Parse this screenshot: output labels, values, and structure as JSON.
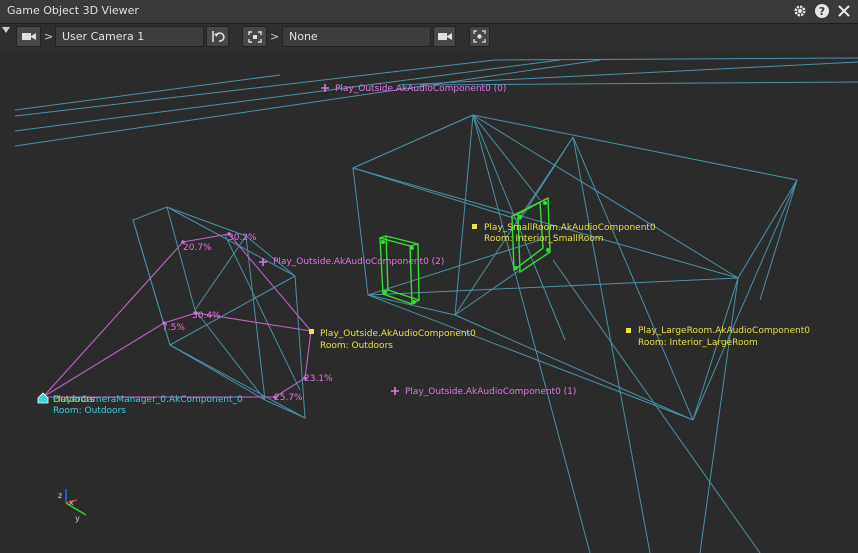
{
  "window": {
    "title": "Game Object 3D Viewer"
  },
  "toolbar": {
    "camera_value": "User Camera 1",
    "target_value": "None",
    "chevron": ">"
  },
  "labels": {
    "outside0_title": "Play_Outside.AkAudioComponent0 (0)",
    "outside1_title": "Play_Outside.AkAudioComponent0 (1)",
    "outside2_title": "Play_Outside.AkAudioComponent0 (2)",
    "outside_main_title": "Play_Outside.AkAudioComponent0",
    "outside_main_room": "Room: Outdoors",
    "small_title": "Play_SmallRoom.AkAudioComponent0",
    "small_room": "Room: Interior_SmallRoom",
    "large_title": "Play_LargeRoom.AkAudioComponent0",
    "large_room": "Room: Interior_LargeRoom",
    "listener_overlap": "Outdoors",
    "listener_title": "PlayerCameraManager_0.AkComponent_0",
    "listener_room": "Room: Outdoors"
  },
  "percentages": {
    "p1": "20.7%",
    "p2": "30.2%",
    "p3": "30.4%",
    "p4": "7.5%",
    "p5": "23.1%",
    "p6": "25.7%"
  },
  "axes": {
    "z": "z",
    "x": "x",
    "y": "y"
  },
  "colors": {
    "wire": "#4a8fa8",
    "path": "#c060c8",
    "emitter": "#e276e4",
    "room_label": "#e8e040",
    "portal": "#30e030",
    "listener": "#3cd0e0"
  },
  "icons": [
    "settings-gear-icon",
    "help-icon",
    "close-icon",
    "camera-icon",
    "reset-view-icon",
    "frame-select-icon",
    "video-camera-icon",
    "focus-target-icon"
  ]
}
